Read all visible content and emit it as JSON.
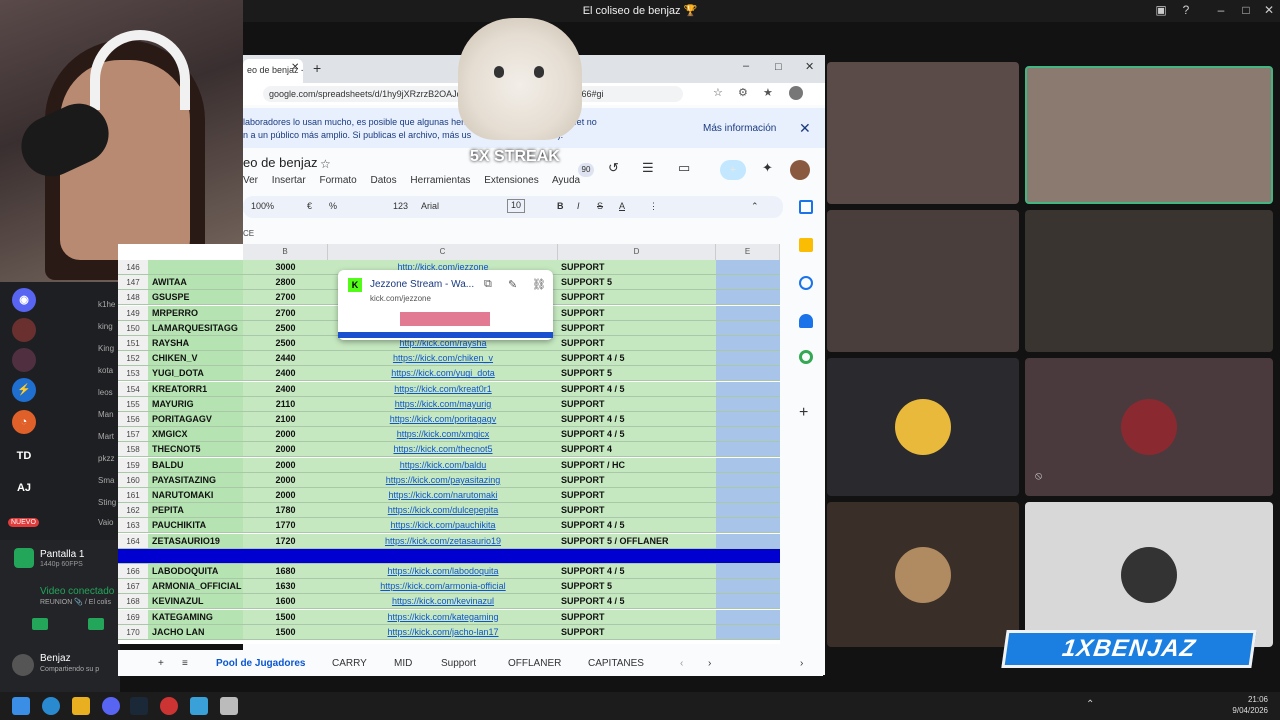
{
  "window": {
    "title": "El coliseo de benjaz 🏆"
  },
  "sidebar": {
    "items": [
      {
        "label": "",
        "name": "k1he"
      },
      {
        "label": "",
        "name": "king"
      },
      {
        "label": "",
        "name": "King"
      },
      {
        "label": "",
        "name": "kota"
      },
      {
        "label": "",
        "name": "leos"
      },
      {
        "label": "",
        "name": "Man"
      },
      {
        "label": "",
        "name": "Mart"
      },
      {
        "label": "",
        "name": "pkzz"
      },
      {
        "label": "",
        "name": "Sma"
      },
      {
        "label": "",
        "name": "Sting"
      },
      {
        "label": "",
        "name": "Vaio"
      }
    ],
    "td": "TD",
    "aj": "AJ",
    "new_badge": "NUEVO",
    "screen_share": "Pantalla 1",
    "screen_share_sub": "1440p 60FPS",
    "voice_status": "Video conectado",
    "voice_channel": "REUNION 📎 / El colis",
    "user_name": "Benjaz",
    "user_status": "Compartiendo su p"
  },
  "browser": {
    "tab_title": "eo de benjaz - Hoja",
    "url": "google.com/spreadsheets/d/1hy9jXRzrzB2OAJq9cSSC",
    "url_tail": "/edit?gid=1615600466#gi"
  },
  "banner": {
    "text": "laboradores lo usan mucho, es posible que algunas herr                           spreadsheet no\nn a un público más amplio. Si publicas el archivo, más us                               ell).",
    "more": "Más información",
    "close": "✕"
  },
  "sheet": {
    "title": "eo de benjaz",
    "menu": [
      "Ver",
      "Insertar",
      "Formato",
      "Datos",
      "Herramientas",
      "Extensiones",
      "Ayuda"
    ],
    "toolbar": {
      "zoom": "100%",
      "font": "Arial",
      "size": "10",
      "euro": "€",
      "percent": "%",
      "num": "123"
    },
    "streak": "5X STREAK",
    "badge": "90",
    "cell_ref": "CE",
    "cols": [
      "B",
      "C",
      "D",
      "E"
    ],
    "rows": [
      {
        "n": "146",
        "name": "",
        "val": "3000",
        "url": "http://kick.com/jezzone",
        "role": "SUPPORT"
      },
      {
        "n": "147",
        "name": "AWITAA",
        "val": "2800",
        "url": "",
        "role": "SUPPORT 5"
      },
      {
        "n": "148",
        "name": "GSUSPE",
        "val": "2700",
        "url": "",
        "role": "SUPPORT"
      },
      {
        "n": "149",
        "name": "MRPERRO",
        "val": "2700",
        "url": "",
        "role": "SUPPORT"
      },
      {
        "n": "150",
        "name": "LAMARQUESITAGG",
        "val": "2500",
        "url": "",
        "role": "SUPPORT"
      },
      {
        "n": "151",
        "name": "RAYSHA",
        "val": "2500",
        "url": "http://kick.com/raysha",
        "role": "SUPPORT"
      },
      {
        "n": "152",
        "name": "CHIKEN_V",
        "val": "2440",
        "url": "https://kick.com/chiken_v",
        "role": "SUPPORT 4 / 5"
      },
      {
        "n": "153",
        "name": "YUGI_DOTA",
        "val": "2400",
        "url": "https://kick.com/yugi_dota",
        "role": "SUPPORT 5"
      },
      {
        "n": "154",
        "name": "KREATORR1",
        "val": "2400",
        "url": "https://kick.com/kreat0r1",
        "role": "SUPPORT 4 / 5"
      },
      {
        "n": "155",
        "name": "MAYURIG",
        "val": "2110",
        "url": "https://kick.com/mayurig",
        "role": "SUPPORT"
      },
      {
        "n": "156",
        "name": "PORITAGAGV",
        "val": "2100",
        "url": "https://kick.com/poritagagv",
        "role": "SUPPORT 4 / 5"
      },
      {
        "n": "157",
        "name": "XMGICX",
        "val": "2000",
        "url": "https://kick.com/xmgicx",
        "role": "SUPPORT 4 / 5"
      },
      {
        "n": "158",
        "name": "THECNOT5",
        "val": "2000",
        "url": "https://kick.com/thecnot5",
        "role": "SUPPORT 4"
      },
      {
        "n": "159",
        "name": "BALDU",
        "val": "2000",
        "url": "https://kick.com/baldu",
        "role": "SUPPORT / HC"
      },
      {
        "n": "160",
        "name": "PAYASITAZING",
        "val": "2000",
        "url": "https://kick.com/payasitazing",
        "role": "SUPPORT"
      },
      {
        "n": "161",
        "name": "NARUTOMAKI",
        "val": "2000",
        "url": "https://kick.com/narutomaki",
        "role": "SUPPORT"
      },
      {
        "n": "162",
        "name": "PEPITA",
        "val": "1780",
        "url": "https://kick.com/dulcepepita",
        "role": "SUPPORT"
      },
      {
        "n": "163",
        "name": "PAUCHIKITA",
        "val": "1770",
        "url": "https://kick.com/pauchikita",
        "role": "SUPPORT 4 / 5"
      },
      {
        "n": "164",
        "name": "ZETASAURIO19",
        "val": "1720",
        "url": "https://kick.com/zetasaurio19",
        "role": "SUPPORT 5 / OFFLANER"
      },
      {
        "n": "165",
        "name": "",
        "val": "",
        "url": "",
        "role": "",
        "selected": true
      },
      {
        "n": "166",
        "name": "LABODOQUITA",
        "val": "1680",
        "url": "https://kick.com/labodoquita",
        "role": "SUPPORT 4 / 5"
      },
      {
        "n": "167",
        "name": "ARMONIA_OFFICIAL",
        "val": "1630",
        "url": "https://kick.com/armonia-official",
        "role": "SUPPORT 5"
      },
      {
        "n": "168",
        "name": "KEVINAZUL",
        "val": "1600",
        "url": "https://kick.com/kevinazul",
        "role": "SUPPORT 4 / 5"
      },
      {
        "n": "169",
        "name": "KATEGAMING",
        "val": "1500",
        "url": "https://kick.com/kategaming",
        "role": "SUPPORT"
      },
      {
        "n": "170",
        "name": "JACHO LAN",
        "val": "1500",
        "url": "https://kick.com/jacho-lan17",
        "role": "SUPPORT"
      }
    ],
    "popup": {
      "title": "Jezzone Stream - Wa...",
      "sub": "kick.com/jezzone"
    },
    "tabs": [
      "Pool de Jugadores",
      "CARRY",
      "MID",
      "Support",
      "OFFLANER",
      "CAPITANES"
    ]
  },
  "overlay": {
    "logo": "1XBENJAZ"
  },
  "taskbar": {
    "time": "21:06",
    "date": "9/04/2026"
  }
}
